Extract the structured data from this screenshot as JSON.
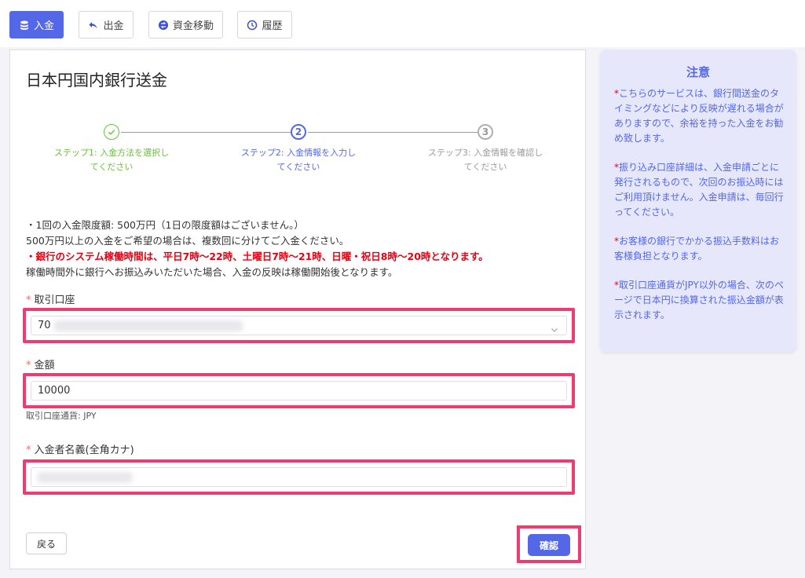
{
  "topbar": {
    "buttons": [
      {
        "label": "入金",
        "icon": "coins-icon",
        "active": true
      },
      {
        "label": "出金",
        "icon": "undo-arrow-icon"
      },
      {
        "label": "資金移動",
        "icon": "transfer-icon"
      },
      {
        "label": "履歴",
        "icon": "history-icon"
      }
    ]
  },
  "form": {
    "title": "日本円国内銀行送金",
    "steps": [
      {
        "number": "",
        "label": "ステップ1: 入金方法を選択してください",
        "state": "done"
      },
      {
        "number": "2",
        "label": "ステップ2: 入金情報を入力してください",
        "state": "active"
      },
      {
        "number": "3",
        "label": "ステップ3: 入金情報を確認してください",
        "state": "pending"
      }
    ],
    "info_lines": [
      "・1回の入金限度額: 500万円（1日の限度額はございません。）",
      "500万円以上の入金をご希望の場合は、複数回に分けてご入金ください。",
      "・銀行のシステム稼働時間は、平日7時〜22時、土曜日7時〜21時、日曜・祝日8時〜20時となります。",
      "稼働時間外に銀行へお振込みいただいた場合、入金の反映は稼働開始後となります。"
    ],
    "required_mark": "*",
    "account_label": "取引口座",
    "account_value": "70",
    "amount_label": "金額",
    "amount_value": "10000",
    "currency_note": "取引口座通貨: JPY",
    "name_label": "入金者名義(全角カナ)",
    "back_label": "戻る",
    "confirm_label": "確認"
  },
  "notice": {
    "title": "注意",
    "items": [
      "こちらのサービスは、銀行間送金のタイミングなどにより反映が遅れる場合がありますので、余裕を持った入金をお勧め致します。",
      "振り込み口座詳細は、入金申請ごとに発行されるもので、次回のお振込時にはご利用頂けません。入金申請は、毎回行ってください。",
      "お客様の銀行でかかる振込手数料はお客様負担となります。",
      "取引口座通貨がJPY以外の場合、次のページで日本円に換算された振込金額が表示されます。"
    ]
  },
  "colors": {
    "primary": "#5468e7",
    "success": "#67c23a",
    "danger": "#e60012",
    "highlight": "#ef3b6f",
    "notice_bg": "#e6e7fb"
  }
}
